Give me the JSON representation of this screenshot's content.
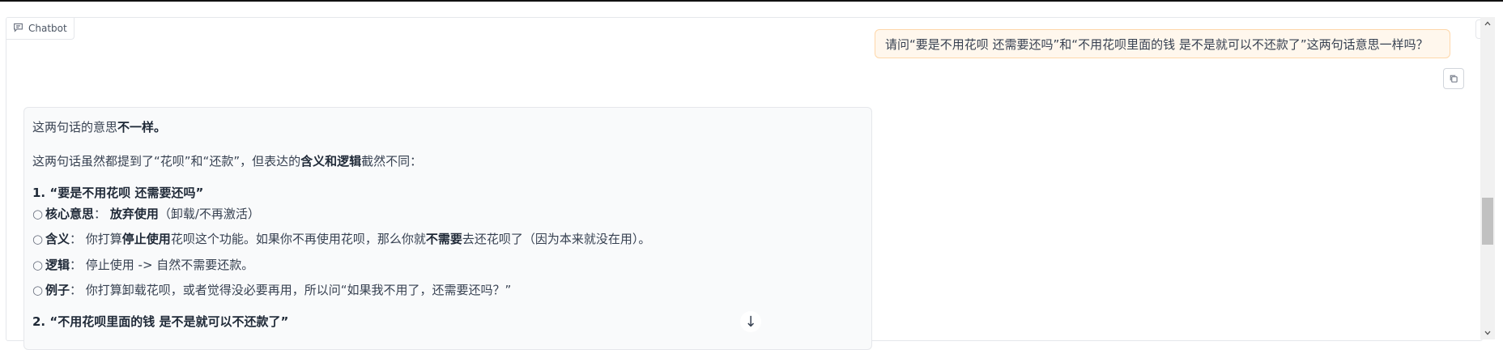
{
  "chatbot": {
    "label": "Chatbot"
  },
  "user_message": {
    "text": "请问“要是不用花呗 还需要还吗”和“不用花呗里面的钱 是不是就可以不还款了”这两句话意思一样吗？"
  },
  "bot_message": {
    "intro_plain": "这两句话的意思",
    "intro_bold": "不一样。",
    "summary_a": "这两句话虽然都提到了“花呗”和“还款”，但表达的",
    "summary_bold": "含义和逻辑",
    "summary_b": "截然不同：",
    "section1_title": "1. “要是不用花呗 还需要还吗”",
    "s1_b1_label": "核心意思",
    "s1_b1_sep": "：",
    "s1_b1_bold": "放弃使用",
    "s1_b1_rest": "（卸载/不再激活）",
    "s1_b2_label": "含义",
    "s1_b2_sep": "： 你打算",
    "s1_b2_bold1": "停止使用",
    "s1_b2_mid": "花呗这个功能。如果你不再使用花呗，那么你就",
    "s1_b2_bold2": "不需要",
    "s1_b2_rest": "去还花呗了（因为本来就没在用）。",
    "s1_b3_label": "逻辑",
    "s1_b3_rest": "： 停止使用 -> 自然不需要还款。",
    "s1_b4_label": "例子",
    "s1_b4_rest": "： 你打算卸载花呗，或者觉得没必要再用，所以问“如果我不用了，还需要还吗？”",
    "section2_title": "2. “不用花呗里面的钱 是不是就可以不还款了”",
    "bullet_symbol": "○"
  },
  "icons": {
    "chat": "chat-bubble-icon",
    "trash": "trash-icon",
    "copy": "copy-icon",
    "scroll_down": "arrow-down-icon",
    "scroll_down_glyph": "↓"
  },
  "colors": {
    "user_bubble_bg": "#fff7ed",
    "user_bubble_border": "#fed7aa",
    "bot_bubble_bg": "#f9fafb"
  }
}
